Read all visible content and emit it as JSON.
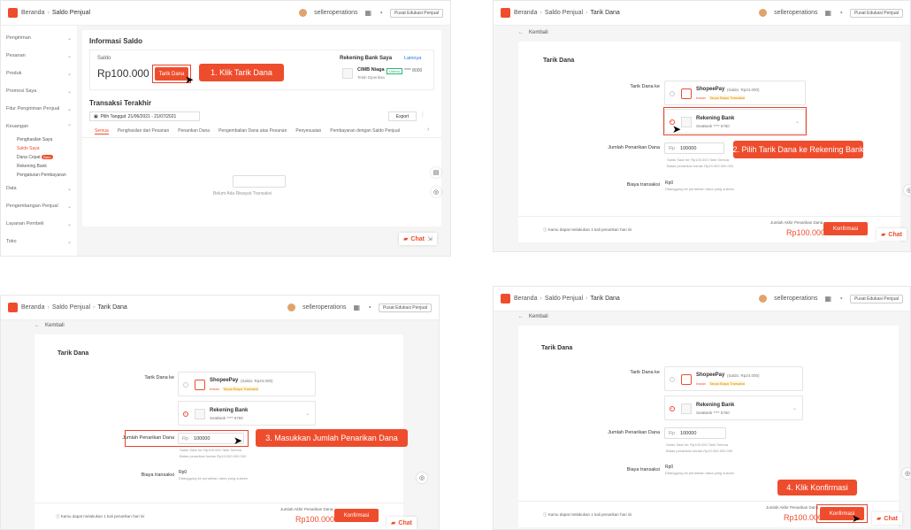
{
  "topbar": {
    "breadcrumb_home": "Beranda",
    "breadcrumb_saldo": "Saldo Penjual",
    "breadcrumb_tarik": "Tarik Dana",
    "user": "selleroperations",
    "seller_center_button": "Pusat Edukasi Penjual",
    "icons": [
      "apps-icon",
      "bell-icon"
    ]
  },
  "sidebar": {
    "items": [
      {
        "label": "Pengiriman"
      },
      {
        "label": "Pesanan"
      },
      {
        "label": "Produk"
      },
      {
        "label": "Promosi Saya"
      },
      {
        "label": "Fitur Pengiriman Penjual"
      },
      {
        "label": "Keuangan"
      },
      {
        "label": "Data"
      },
      {
        "label": "Pengembangan Penjual"
      },
      {
        "label": "Layanan Pembeli"
      },
      {
        "label": "Toko"
      }
    ],
    "keuangan_sub": [
      "Penghasilan Saya",
      "Saldo Saya",
      "Dana Cepat",
      "Rekening Bank",
      "Pengaturan Pembayaran"
    ],
    "dana_cepat_badge": "Baru"
  },
  "panel1": {
    "info_title": "Informasi Saldo",
    "saldo_label": "Saldo",
    "saldo_value": "Rp100.000",
    "tarik_button": "Tarik Dana",
    "step": "1. Klik Tarik Dana",
    "rekening_title": "Rekening Bank Saya",
    "lainnya_link": "Lainnya",
    "bank_name": "CIMB Niaga",
    "bank_status": "Telah Diperiksa",
    "bank_tag": "Utama",
    "bank_number": "**** 8000",
    "transaksi_title": "Transaksi Terakhir",
    "date_filter": "Pilih Tanggal: 21/06/2021 - 21/07/2021",
    "export_button": "Export",
    "tabs": [
      "Semua",
      "Penghasilan dari Pesanan",
      "Penarikan Dana",
      "Pengembalian Dana atas Pesanan",
      "Penyesuaian",
      "Pembayaran dengan Saldo Penjual"
    ],
    "empty_text": "Belum Ada Riwayat Transaksi"
  },
  "withdraw": {
    "back_label": "Kembali",
    "page_title": "Tarik Dana",
    "to_label": "Tarik Dana ke",
    "shopeepay_name": "ShopeePay",
    "shopeepay_balance": "(Saldo: Rp24.000)",
    "shopeepay_tag1": "Instan",
    "shopeepay_tag2": "Tanpa Biaya Transaksi",
    "bank_label": "Rekening Bank",
    "bank_detail": "SeaBank  **** 5760",
    "amount_label": "Jumlah Penarikan Dana",
    "currency": "Rp",
    "amount_value": "100000",
    "amount_note1": "Saldo Saat Ini: Rp100.000  Tarik Semua",
    "amount_note2": "Batas penarikan harian Rp10.000.000.000",
    "fee_label": "Biaya transaksi",
    "fee_value": "Rp0",
    "fee_note": "Ditanggung ke penarikan dana yang sukses",
    "footer_note": "Kamu dapat melakukan 1 kali penarikan hari ini",
    "total_label": "Jumlah Akhir Penarikan Dana",
    "total_value": "Rp100.000",
    "confirm_button": "Konfirmasi",
    "chat_label": "Chat",
    "step2": "2. Pilih Tarik Dana ke Rekening Bank",
    "step3": "3. Masukkan Jumlah Penarikan Dana",
    "step4": "4. Klik Konfirmasi"
  },
  "colors": {
    "accent": "#ee4d2d",
    "callout_border": "#e8432b"
  }
}
